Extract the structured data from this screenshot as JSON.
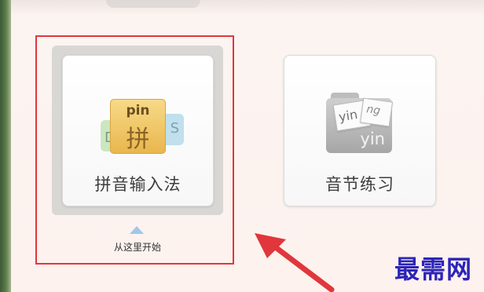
{
  "cards": [
    {
      "label": "拼音输入法",
      "icon": "pinyin-tiles-icon",
      "icon_text": "pin",
      "icon_glyph": "拼",
      "back_letters": [
        "D",
        "S"
      ]
    },
    {
      "label": "音节练习",
      "icon": "syllable-cards-icon",
      "paper_texts": [
        "yin",
        "ng"
      ],
      "folder_text": "yin"
    }
  ],
  "start_hint": "从这里开始",
  "watermark": "最需网",
  "colors": {
    "highlight": "#e0363c",
    "arrow": "#e0363c",
    "watermark": "#2c24b8",
    "start_arrow": "#9ec8ea"
  }
}
